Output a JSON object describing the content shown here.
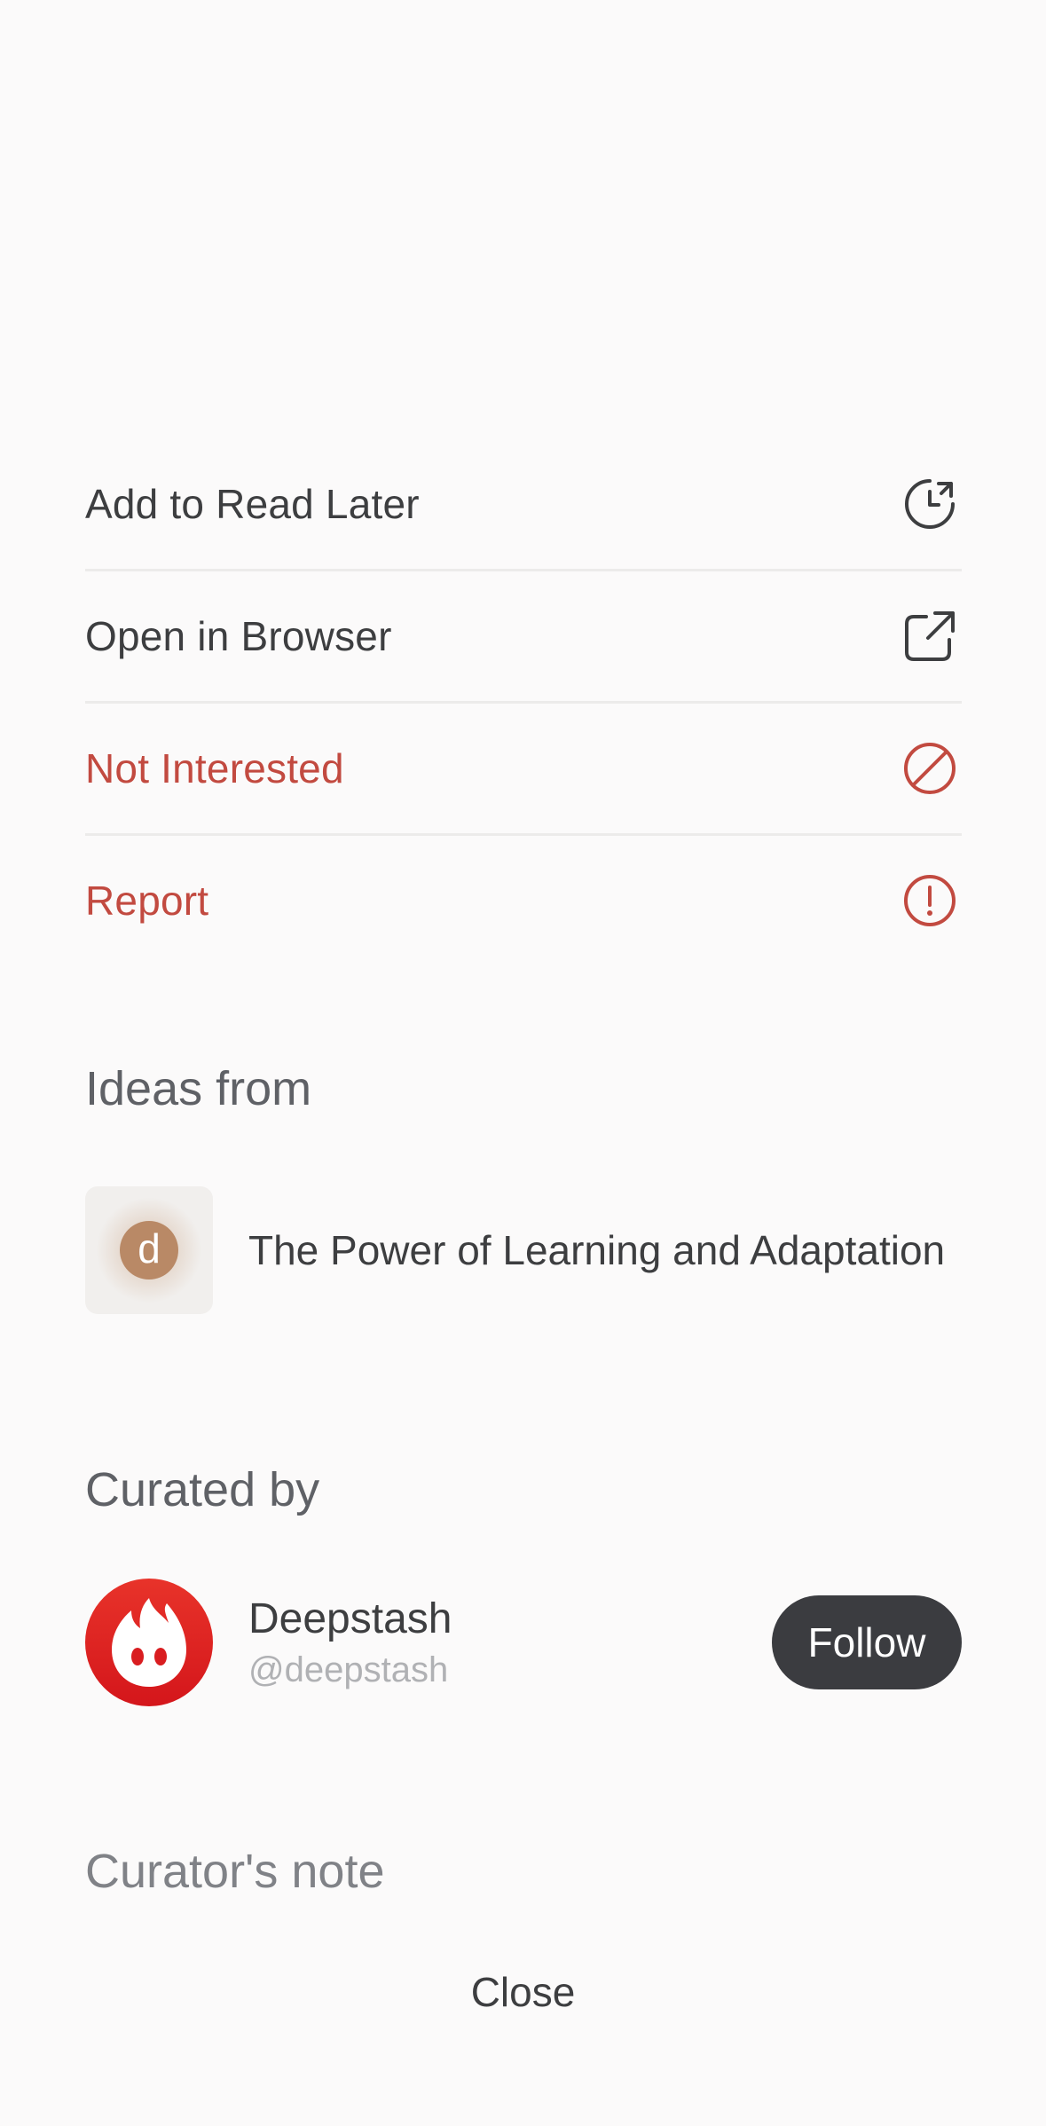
{
  "menu": {
    "items": [
      {
        "label": "Add to Read Later",
        "icon": "clock-refresh-icon",
        "tone": "normal"
      },
      {
        "label": "Open in Browser",
        "icon": "external-link-icon",
        "tone": "normal"
      },
      {
        "label": "Not Interested",
        "icon": "block-icon",
        "tone": "danger"
      },
      {
        "label": "Report",
        "icon": "alert-circle-icon",
        "tone": "danger"
      }
    ]
  },
  "ideas_from": {
    "title": "Ideas from",
    "source_letter": "d",
    "source_title": "The Power of Learning and Adaptation"
  },
  "curated_by": {
    "title": "Curated by",
    "name": "Deepstash",
    "handle": "@deepstash",
    "follow_label": "Follow",
    "avatar_icon": "flame-logo-icon"
  },
  "curators_note": {
    "title": "Curator's note"
  },
  "close_label": "Close",
  "colors": {
    "background": "#fbfafa",
    "text": "#3d3e40",
    "danger": "#c24a40",
    "divider": "#ecebea",
    "follow_button": "#3b3c40",
    "brand_red": "#e8332a"
  }
}
